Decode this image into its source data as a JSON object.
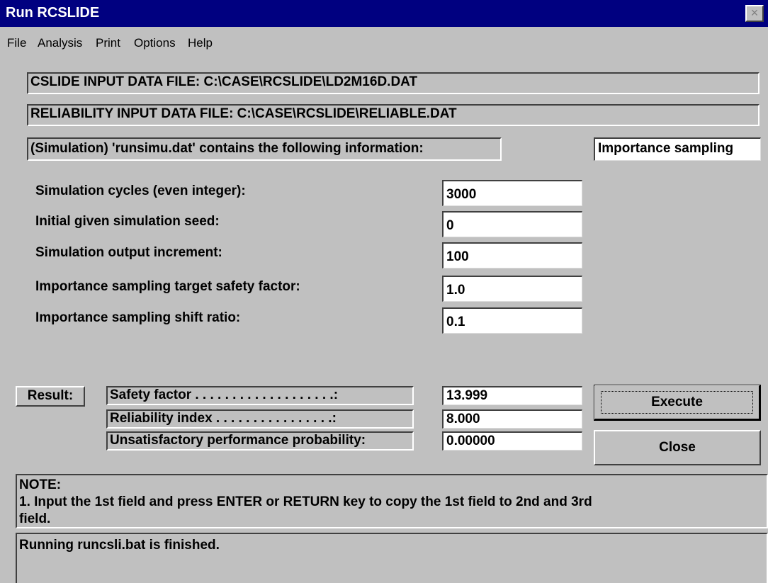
{
  "window": {
    "title": "Run RCSLIDE",
    "close_glyph": "×"
  },
  "menu": [
    "File",
    "Analysis",
    "Print",
    "Options",
    "Help"
  ],
  "files": {
    "cslide_input": "CSLIDE INPUT DATA FILE: C:\\CASE\\RCSLIDE\\LD2M16D.DAT",
    "reliability_input": "RELIABILITY INPUT DATA FILE: C:\\CASE\\RCSLIDE\\RELIABLE.DAT"
  },
  "simulation": {
    "info_label": "(Simulation) 'runsimu.dat' contains the following information:",
    "method": "Importance sampling"
  },
  "form": {
    "fields": [
      {
        "label": "Simulation cycles (even integer):",
        "value": "3000"
      },
      {
        "label": "Initial given simulation seed:",
        "value": "0"
      },
      {
        "label": "Simulation output increment:",
        "value": "100"
      },
      {
        "label": "Importance sampling target safety factor:",
        "value": "1.0"
      },
      {
        "label": "Importance sampling shift ratio:",
        "value": "0.1"
      }
    ]
  },
  "result": {
    "label": "Result:",
    "rows": [
      {
        "label": "Safety factor . . . . . . . . . . . . . . . . . . .:",
        "value": "13.999"
      },
      {
        "label": "Reliability index . . . . . . . . . . . . . . . .:",
        "value": "8.000"
      },
      {
        "label": "Unsatisfactory performance probability:",
        "value": "0.00000"
      }
    ]
  },
  "buttons": {
    "execute": "Execute",
    "close": "Close"
  },
  "note": {
    "title": "NOTE:",
    "line1": "1. Input the 1st field and press ENTER or RETURN key to copy the 1st field to 2nd and 3rd",
    "line2": "field."
  },
  "status": "Running runcsli.bat is finished.",
  "colors": {
    "titlebar": "#000080",
    "face": "#c0c0c0",
    "field": "#ffffff"
  }
}
